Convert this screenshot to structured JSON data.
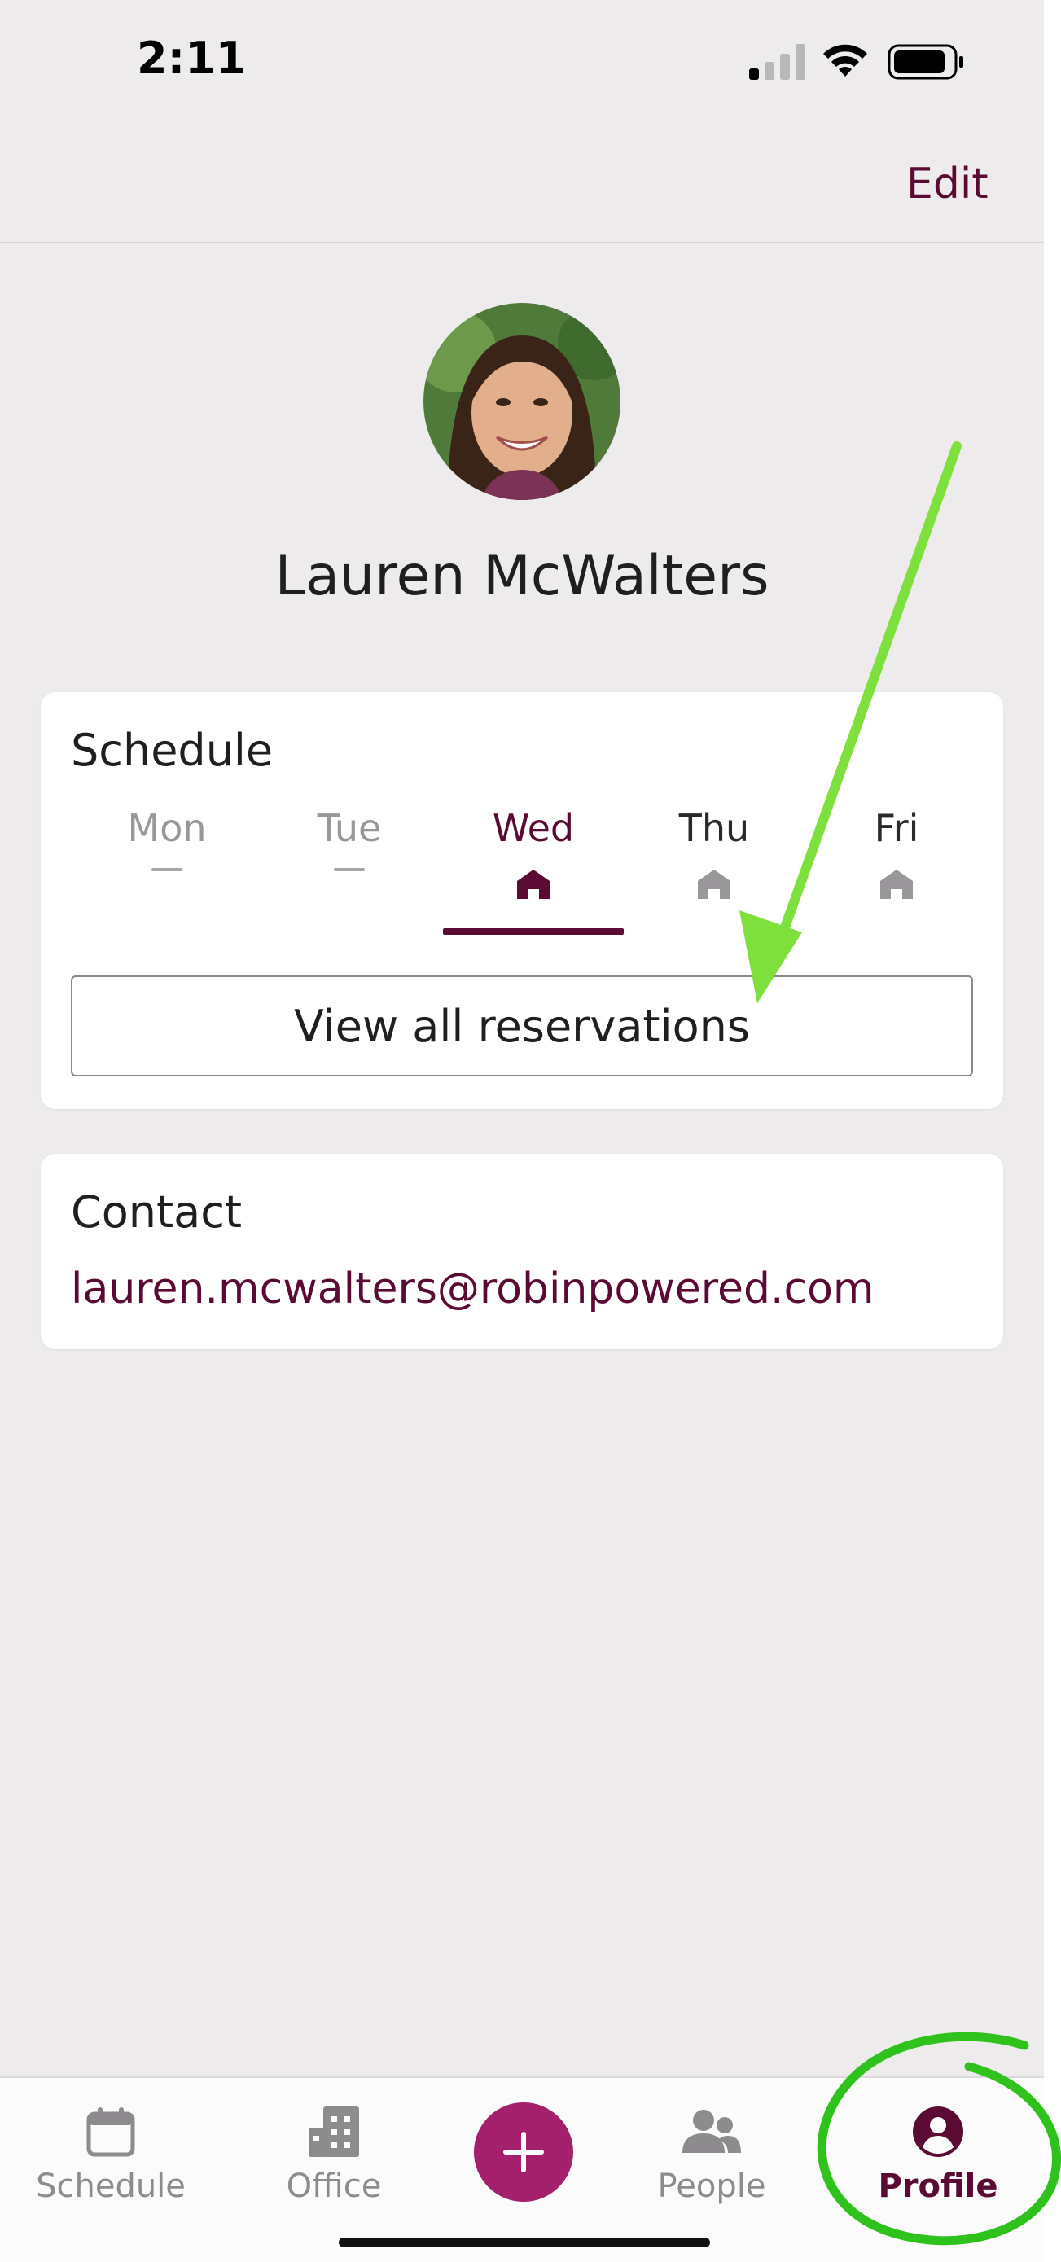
{
  "status_bar": {
    "time": "2:11",
    "icons": [
      "signal-icon",
      "wifi-icon",
      "battery-icon"
    ]
  },
  "header": {
    "edit_label": "Edit"
  },
  "profile": {
    "name": "Lauren McWalters"
  },
  "schedule": {
    "title": "Schedule",
    "days": [
      {
        "label": "Mon",
        "status": "none"
      },
      {
        "label": "Tue",
        "status": "none"
      },
      {
        "label": "Wed",
        "status": "home",
        "selected": true
      },
      {
        "label": "Thu",
        "status": "home"
      },
      {
        "label": "Fri",
        "status": "home"
      }
    ],
    "view_all_label": "View all reservations"
  },
  "contact": {
    "title": "Contact",
    "email": "lauren.mcwalters@robinpowered.com"
  },
  "tabbar": {
    "items": [
      {
        "label": "Schedule",
        "icon": "calendar-icon"
      },
      {
        "label": "Office",
        "icon": "building-icon"
      },
      {
        "label": "",
        "icon": "plus-icon"
      },
      {
        "label": "People",
        "icon": "people-icon"
      },
      {
        "label": "Profile",
        "icon": "person-circle-icon",
        "active": true
      }
    ]
  },
  "colors": {
    "accent": "#5b0a34",
    "fab": "#a41f6c",
    "annotation_green": "#7ee03c",
    "annotation_circle": "#2fc21d"
  }
}
